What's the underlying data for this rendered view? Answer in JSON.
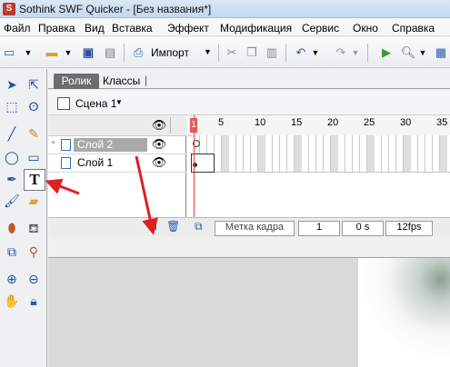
{
  "window": {
    "title": "Sothink SWF Quicker - [Без названия*]",
    "app_icon": "S"
  },
  "menu": [
    "Файл",
    "Правка",
    "Вид",
    "Вставка",
    "Эффект",
    "Модификация",
    "Сервис",
    "Окно",
    "Справка"
  ],
  "toolbar": {
    "import_label": "Импорт"
  },
  "tabs": [
    "Ролик",
    "Классы"
  ],
  "scene": {
    "label": "Сцена 1"
  },
  "layers": [
    {
      "name": "Слой 2",
      "selected": true
    },
    {
      "name": "Слой 1",
      "selected": false
    }
  ],
  "timeline": {
    "ruler": [
      "1",
      "5",
      "10",
      "15",
      "20",
      "25",
      "30",
      "35"
    ],
    "current_frame_marker": "1",
    "frame_label_placeholder": "Метка кадра",
    "frame": "1",
    "time": "0 s",
    "fps": "12fps"
  },
  "colors": {
    "annotation": "#e02020",
    "playhead": "#e53d3d"
  }
}
